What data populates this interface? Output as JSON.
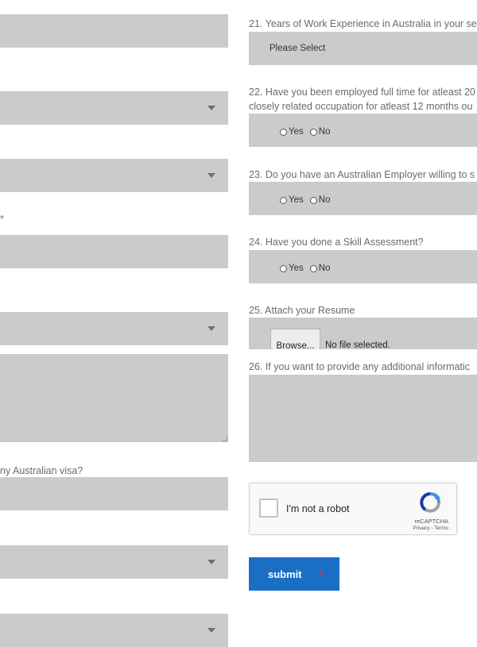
{
  "left_column": {
    "fields": [
      {
        "type": "text"
      },
      {
        "type": "select"
      },
      {
        "type": "select"
      },
      {
        "type": "text"
      },
      {
        "type": "select"
      },
      {
        "type": "textarea"
      },
      {
        "type": "text"
      },
      {
        "type": "select"
      },
      {
        "type": "select"
      }
    ],
    "label_star": "*",
    "label_visa": "ny Australian visa?"
  },
  "right_column": {
    "q21": {
      "label": "21. Years of Work Experience in Australia in your se",
      "selected": "Please Select"
    },
    "q22": {
      "label_line1": "22. Have you been employed full time for atleast 20",
      "label_line2": "closely related occupation for atleast 12 months ou",
      "options": [
        "Yes",
        "No"
      ]
    },
    "q23": {
      "label": "23. Do you have an Australian Employer willing to s",
      "options": [
        "Yes",
        "No"
      ]
    },
    "q24": {
      "label": "24. Have you done a Skill Assessment?",
      "options": [
        "Yes",
        "No"
      ]
    },
    "q25": {
      "label": "25. Attach your Resume",
      "browse_label": "Browse...",
      "file_status": "No file selected."
    },
    "q26": {
      "label": "26. If you want to provide any additional informatic"
    }
  },
  "recaptcha": {
    "label": "I'm not a robot",
    "brand": "reCAPTCHA",
    "terms": "Privacy - Terms",
    "icon": "recaptcha-logo-icon"
  },
  "submit": {
    "label": "submit",
    "arrow": "›",
    "color": "#1a6fc4",
    "arrow_color": "#e0313c"
  },
  "colors": {
    "field_bg": "#cbcbcb",
    "label_text": "#6b6b6b"
  }
}
